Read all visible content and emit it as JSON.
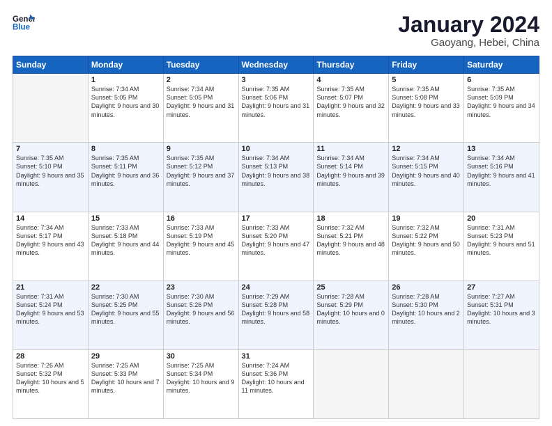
{
  "header": {
    "logo_line1": "General",
    "logo_line2": "Blue",
    "month": "January 2024",
    "location": "Gaoyang, Hebei, China"
  },
  "days_of_week": [
    "Sunday",
    "Monday",
    "Tuesday",
    "Wednesday",
    "Thursday",
    "Friday",
    "Saturday"
  ],
  "weeks": [
    {
      "row_style": "row-white",
      "days": [
        {
          "num": "",
          "empty": true
        },
        {
          "num": "1",
          "rise": "7:34 AM",
          "set": "5:05 PM",
          "daylight": "9 hours and 30 minutes."
        },
        {
          "num": "2",
          "rise": "7:34 AM",
          "set": "5:05 PM",
          "daylight": "9 hours and 31 minutes."
        },
        {
          "num": "3",
          "rise": "7:35 AM",
          "set": "5:06 PM",
          "daylight": "9 hours and 31 minutes."
        },
        {
          "num": "4",
          "rise": "7:35 AM",
          "set": "5:07 PM",
          "daylight": "9 hours and 32 minutes."
        },
        {
          "num": "5",
          "rise": "7:35 AM",
          "set": "5:08 PM",
          "daylight": "9 hours and 33 minutes."
        },
        {
          "num": "6",
          "rise": "7:35 AM",
          "set": "5:09 PM",
          "daylight": "9 hours and 34 minutes."
        }
      ]
    },
    {
      "row_style": "row-blue",
      "days": [
        {
          "num": "7",
          "rise": "7:35 AM",
          "set": "5:10 PM",
          "daylight": "9 hours and 35 minutes."
        },
        {
          "num": "8",
          "rise": "7:35 AM",
          "set": "5:11 PM",
          "daylight": "9 hours and 36 minutes."
        },
        {
          "num": "9",
          "rise": "7:35 AM",
          "set": "5:12 PM",
          "daylight": "9 hours and 37 minutes."
        },
        {
          "num": "10",
          "rise": "7:34 AM",
          "set": "5:13 PM",
          "daylight": "9 hours and 38 minutes."
        },
        {
          "num": "11",
          "rise": "7:34 AM",
          "set": "5:14 PM",
          "daylight": "9 hours and 39 minutes."
        },
        {
          "num": "12",
          "rise": "7:34 AM",
          "set": "5:15 PM",
          "daylight": "9 hours and 40 minutes."
        },
        {
          "num": "13",
          "rise": "7:34 AM",
          "set": "5:16 PM",
          "daylight": "9 hours and 41 minutes."
        }
      ]
    },
    {
      "row_style": "row-white",
      "days": [
        {
          "num": "14",
          "rise": "7:34 AM",
          "set": "5:17 PM",
          "daylight": "9 hours and 43 minutes."
        },
        {
          "num": "15",
          "rise": "7:33 AM",
          "set": "5:18 PM",
          "daylight": "9 hours and 44 minutes."
        },
        {
          "num": "16",
          "rise": "7:33 AM",
          "set": "5:19 PM",
          "daylight": "9 hours and 45 minutes."
        },
        {
          "num": "17",
          "rise": "7:33 AM",
          "set": "5:20 PM",
          "daylight": "9 hours and 47 minutes."
        },
        {
          "num": "18",
          "rise": "7:32 AM",
          "set": "5:21 PM",
          "daylight": "9 hours and 48 minutes."
        },
        {
          "num": "19",
          "rise": "7:32 AM",
          "set": "5:22 PM",
          "daylight": "9 hours and 50 minutes."
        },
        {
          "num": "20",
          "rise": "7:31 AM",
          "set": "5:23 PM",
          "daylight": "9 hours and 51 minutes."
        }
      ]
    },
    {
      "row_style": "row-blue",
      "days": [
        {
          "num": "21",
          "rise": "7:31 AM",
          "set": "5:24 PM",
          "daylight": "9 hours and 53 minutes."
        },
        {
          "num": "22",
          "rise": "7:30 AM",
          "set": "5:25 PM",
          "daylight": "9 hours and 55 minutes."
        },
        {
          "num": "23",
          "rise": "7:30 AM",
          "set": "5:26 PM",
          "daylight": "9 hours and 56 minutes."
        },
        {
          "num": "24",
          "rise": "7:29 AM",
          "set": "5:28 PM",
          "daylight": "9 hours and 58 minutes."
        },
        {
          "num": "25",
          "rise": "7:28 AM",
          "set": "5:29 PM",
          "daylight": "10 hours and 0 minutes."
        },
        {
          "num": "26",
          "rise": "7:28 AM",
          "set": "5:30 PM",
          "daylight": "10 hours and 2 minutes."
        },
        {
          "num": "27",
          "rise": "7:27 AM",
          "set": "5:31 PM",
          "daylight": "10 hours and 3 minutes."
        }
      ]
    },
    {
      "row_style": "row-white",
      "days": [
        {
          "num": "28",
          "rise": "7:26 AM",
          "set": "5:32 PM",
          "daylight": "10 hours and 5 minutes."
        },
        {
          "num": "29",
          "rise": "7:25 AM",
          "set": "5:33 PM",
          "daylight": "10 hours and 7 minutes."
        },
        {
          "num": "30",
          "rise": "7:25 AM",
          "set": "5:34 PM",
          "daylight": "10 hours and 9 minutes."
        },
        {
          "num": "31",
          "rise": "7:24 AM",
          "set": "5:36 PM",
          "daylight": "10 hours and 11 minutes."
        },
        {
          "num": "",
          "empty": true
        },
        {
          "num": "",
          "empty": true
        },
        {
          "num": "",
          "empty": true
        }
      ]
    }
  ]
}
